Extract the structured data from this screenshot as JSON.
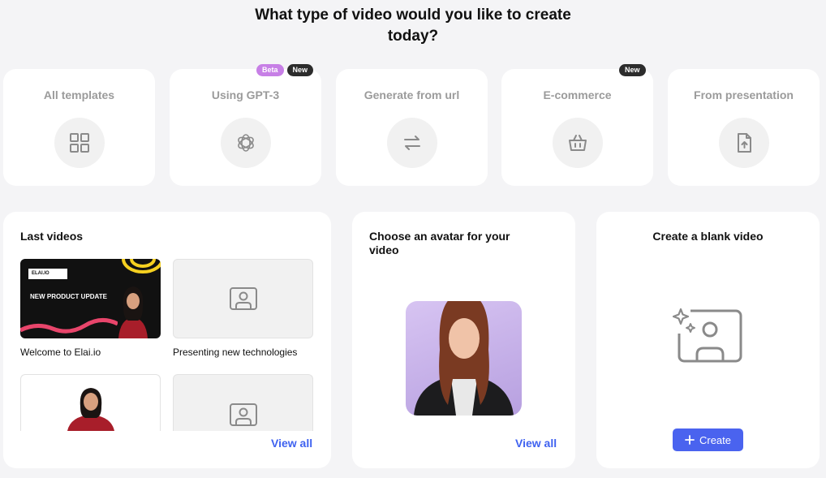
{
  "page": {
    "title_line1": "What type of video would you like to create",
    "title_line2": "today?"
  },
  "types": [
    {
      "label": "All templates",
      "icon": "grid-icon",
      "badges": []
    },
    {
      "label": "Using GPT-3",
      "icon": "openai-icon",
      "badges": [
        "Beta",
        "New"
      ]
    },
    {
      "label": "Generate from url",
      "icon": "arrows-swap-icon",
      "badges": []
    },
    {
      "label": "E-commerce",
      "icon": "basket-icon",
      "badges": [
        "New"
      ]
    },
    {
      "label": "From presentation",
      "icon": "file-upload-icon",
      "badges": []
    }
  ],
  "last_videos": {
    "title": "Last videos",
    "view_all": "View all",
    "items": [
      {
        "caption": "Welcome to Elai.io",
        "promo_logo": "ELAI.IO",
        "promo_text": "NEW PRODUCT UPDATE"
      },
      {
        "caption": "Presenting new technologies"
      },
      {
        "caption": ""
      },
      {
        "caption": ""
      }
    ]
  },
  "avatar": {
    "title": "Choose an avatar for your video",
    "view_all": "View all"
  },
  "blank": {
    "title": "Create a blank video",
    "create_label": "Create"
  },
  "colors": {
    "accent": "#4a63ef",
    "link": "#3f62f0",
    "beta_badge": "#c77fe6",
    "new_badge": "#2c2c2c",
    "background": "#f4f4f6"
  }
}
